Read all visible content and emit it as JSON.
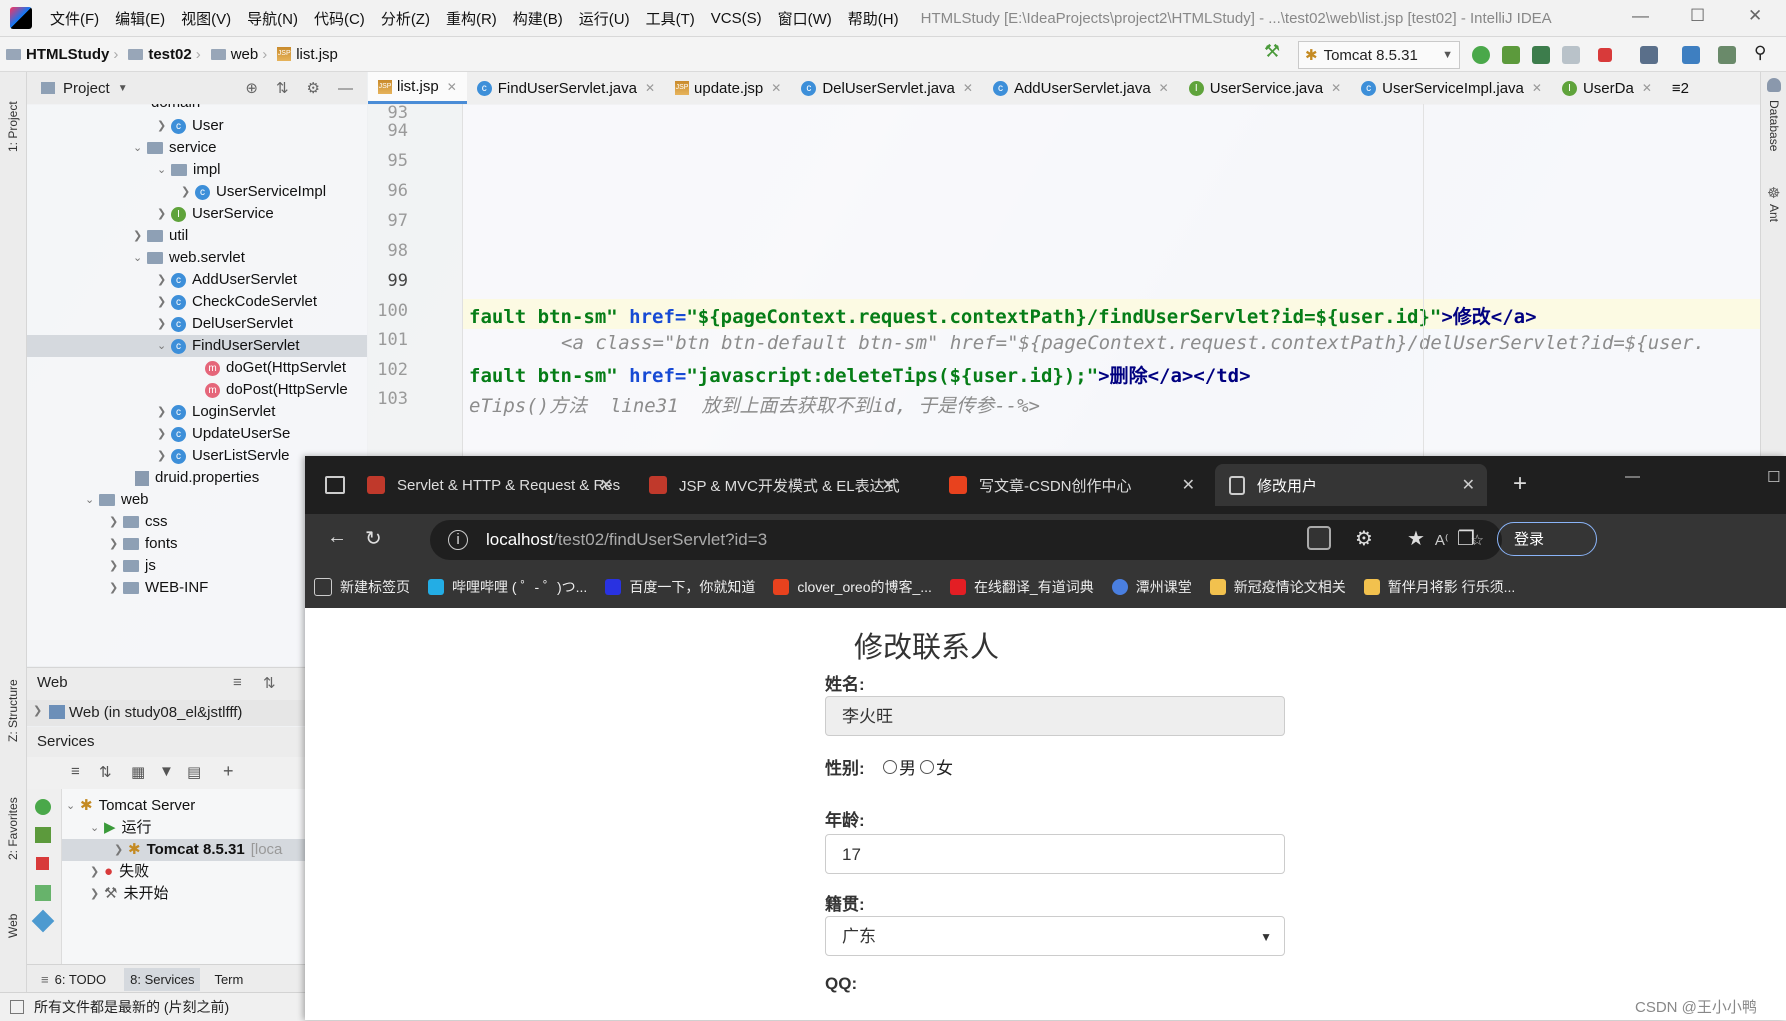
{
  "ide": {
    "menu": [
      "文件(F)",
      "编辑(E)",
      "视图(V)",
      "导航(N)",
      "代码(C)",
      "分析(Z)",
      "重构(R)",
      "构建(B)",
      "运行(U)",
      "工具(T)",
      "VCS(S)",
      "窗口(W)",
      "帮助(H)"
    ],
    "window_title": "HTMLStudy [E:\\IdeaProjects\\project2\\HTMLStudy] - ...\\test02\\web\\list.jsp [test02] - IntelliJ IDEA",
    "breadcrumb": [
      "HTMLStudy",
      "test02",
      "web",
      "list.jsp"
    ],
    "run_config": "Tomcat 8.5.31",
    "left_stripe": [
      "1: Project",
      "Z: Structure",
      "2: Favorites",
      "Web"
    ],
    "right_stripe": [
      "Database",
      "Ant"
    ],
    "project_panel_title": "Project",
    "tree": [
      {
        "label": "domain",
        "icon": "folder"
      },
      {
        "label": "User",
        "icon": "class"
      },
      {
        "label": "service",
        "icon": "package"
      },
      {
        "label": "impl",
        "icon": "package"
      },
      {
        "label": "UserServiceImpl",
        "icon": "class"
      },
      {
        "label": "UserService",
        "icon": "interface"
      },
      {
        "label": "util",
        "icon": "package"
      },
      {
        "label": "web.servlet",
        "icon": "package"
      },
      {
        "label": "AddUserServlet",
        "icon": "class"
      },
      {
        "label": "CheckCodeServlet",
        "icon": "class"
      },
      {
        "label": "DelUserServlet",
        "icon": "class"
      },
      {
        "label": "FindUserServlet",
        "icon": "class"
      },
      {
        "label": "doGet(HttpServlet",
        "icon": "method"
      },
      {
        "label": "doPost(HttpServle",
        "icon": "method"
      },
      {
        "label": "LoginServlet",
        "icon": "class"
      },
      {
        "label": "UpdateUserSe",
        "icon": "class"
      },
      {
        "label": "UserListServle",
        "icon": "class"
      },
      {
        "label": "druid.properties",
        "icon": "properties"
      },
      {
        "label": "web",
        "icon": "folder"
      },
      {
        "label": "css",
        "icon": "folder"
      },
      {
        "label": "fonts",
        "icon": "folder"
      },
      {
        "label": "js",
        "icon": "folder"
      },
      {
        "label": "WEB-INF",
        "icon": "folder"
      }
    ],
    "web_panel_title": "Web",
    "web_item": "Web (in study08_el&jstlfff)",
    "services_panel_title": "Services",
    "services_tree": [
      "Tomcat Server",
      "运行",
      "Tomcat 8.5.31",
      "[loca",
      "失败",
      "未开始"
    ],
    "bottom_tabs": [
      "6: TODO",
      "8: Services",
      "Term"
    ],
    "status_text": "所有文件都是最新的 (片刻之前)",
    "editor_tabs": [
      "list.jsp",
      "FindUserServlet.java",
      "update.jsp",
      "DelUserServlet.java",
      "AddUserServlet.java",
      "UserService.java",
      "UserServiceImpl.java",
      "UserDa",
      "≡2"
    ],
    "line_numbers": [
      "93",
      "94",
      "95",
      "96",
      "97",
      "98",
      "99",
      "100",
      "101",
      "102",
      "103"
    ],
    "code_lines": {
      "l99": [
        "fault btn-sm\" ",
        "href=",
        "\"${pageContext.request.contextPath}/findUserServlet?id=${user.id}\"",
        ">修改</a>"
      ],
      "l100": "<a class=\"btn btn-default btn-sm\" href=\"${pageContext.request.contextPath}/delUserServlet?id=${user.",
      "l101": [
        "fault btn-sm\" ",
        "href=",
        "\"javascript:deleteTips(${user.id});\"",
        ">删除</a></td>"
      ],
      "l102": "eTips()方法  line31  放到上面去获取不到id, 于是传参--%>"
    }
  },
  "browser": {
    "tabs": [
      "Servlet & HTTP & Request & Res",
      "JSP & MVC开发模式 & EL表达式",
      "写文章-CSDN创作中心",
      "修改用户"
    ],
    "url_host": "localhost",
    "url_path": "/test02/findUserServlet?id=3",
    "login_label": "登录",
    "bookmarks": [
      "新建标签页",
      "哔哩哔哩 ( ゜- ゜)つ...",
      "百度一下，你就知道",
      "clover_oreo的博客_...",
      "在线翻译_有道词典",
      "潭州课堂",
      "新冠疫情论文相关",
      "暂伴月将影 行乐须..."
    ],
    "page": {
      "heading": "修改联系人",
      "name_label": "姓名:",
      "name_value": "李火旺",
      "gender_label": "性别:",
      "gender_male": "男",
      "gender_female": "女",
      "age_label": "年龄:",
      "age_value": "17",
      "origin_label": "籍贯:",
      "origin_value": "广东",
      "qq_label": "QQ:"
    }
  },
  "watermark": "CSDN @王小小鸭"
}
